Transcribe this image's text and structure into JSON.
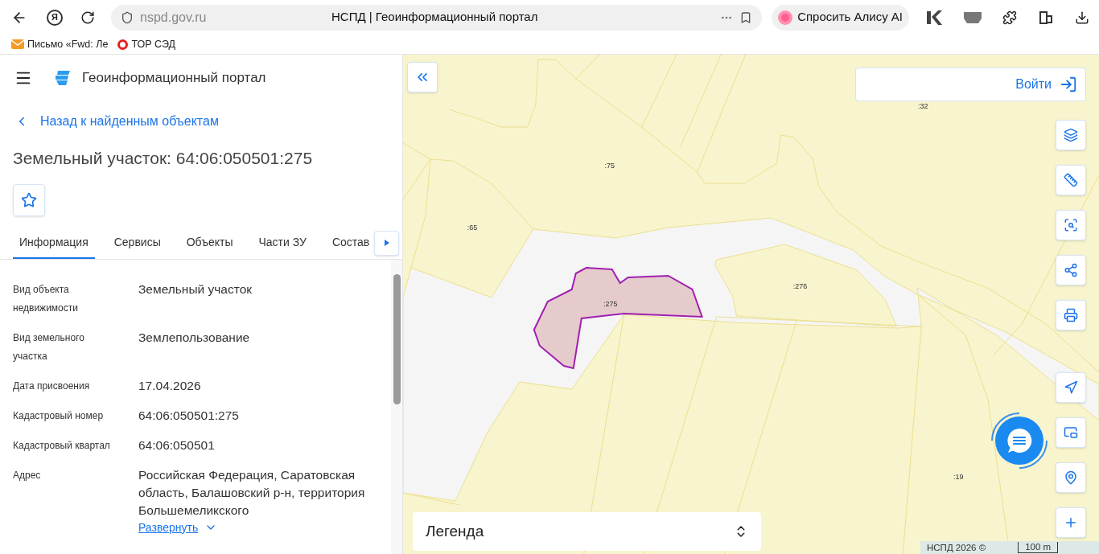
{
  "browser": {
    "yandex_button": "Я",
    "address": "nspd.gov.ru",
    "tab_title": "НСПД | Геоинформационный портал",
    "alice_button": "Спросить Алису AI",
    "bookmarks": [
      {
        "label": "Письмо «Fwd: Ле"
      },
      {
        "label": "ТОР СЭД"
      }
    ]
  },
  "app": {
    "title": "Геоинформационный портал",
    "back_link": "Назад к найденным объектам",
    "heading": "Земельный участок: 64:06:050501:275",
    "tabs": [
      {
        "label": "Информация",
        "selected": true
      },
      {
        "label": "Сервисы",
        "selected": false
      },
      {
        "label": "Объекты",
        "selected": false
      },
      {
        "label": "Части ЗУ",
        "selected": false
      },
      {
        "label": "Состав",
        "selected": false
      }
    ],
    "properties": [
      {
        "label": "Вид объекта недвижимости",
        "value": "Земельный участок"
      },
      {
        "label": "Вид земельного участка",
        "value": "Землепользование"
      },
      {
        "label": "Дата присвоения",
        "value": "17.04.2026"
      },
      {
        "label": "Кадастровый номер",
        "value": "64:06:050501:275"
      },
      {
        "label": "Кадастровый квартал",
        "value": "64:06:050501"
      },
      {
        "label": "Адрес",
        "value": "Российская Федерация, Саратовская область, Балашовский р-н, территория Большемеликского"
      }
    ],
    "expand_link": "Развернуть"
  },
  "map": {
    "labels": [
      ":32",
      ":75",
      ":65",
      ":275",
      ":276",
      ":19"
    ],
    "login_button": "Войти",
    "legend_title": "Легенда",
    "attribution": "НСПД 2026 ©",
    "scale": "100 m"
  }
}
